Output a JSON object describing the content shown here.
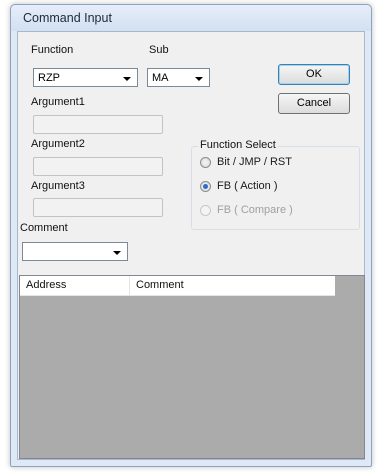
{
  "window": {
    "title": "Command Input"
  },
  "fields": {
    "function": {
      "label": "Function",
      "value": "RZP"
    },
    "sub": {
      "label": "Sub",
      "value": "MA"
    },
    "argument1": {
      "label": "Argument1",
      "value": ""
    },
    "argument2": {
      "label": "Argument2",
      "value": ""
    },
    "argument3": {
      "label": "Argument3",
      "value": ""
    },
    "comment": {
      "label": "Comment",
      "value": ""
    }
  },
  "buttons": {
    "ok": "OK",
    "cancel": "Cancel"
  },
  "function_select": {
    "title": "Function Select",
    "options": [
      {
        "label": "Bit / JMP / RST",
        "selected": false,
        "enabled": true
      },
      {
        "label": "FB ( Action )",
        "selected": true,
        "enabled": true
      },
      {
        "label": "FB ( Compare )",
        "selected": false,
        "enabled": false
      }
    ]
  },
  "table": {
    "columns": [
      "Address",
      "Comment"
    ],
    "rows": []
  },
  "colors": {
    "accent": "#2a6fc6",
    "window_frame": "#dfe9f5",
    "list_background": "#ababab"
  }
}
